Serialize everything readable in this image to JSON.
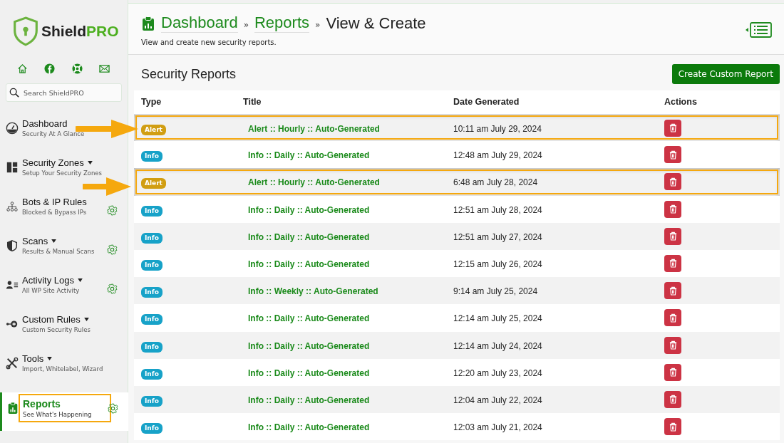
{
  "brand": {
    "name": "Shield",
    "suffix": "PRO"
  },
  "search": {
    "placeholder": "Search ShieldPRO"
  },
  "nav": [
    {
      "title": "Dashboard",
      "subtitle": "Security At A Glance",
      "caret": false,
      "gear": false,
      "selected": false,
      "highlighted": false
    },
    {
      "title": "Security Zones",
      "subtitle": "Setup Your Security Zones",
      "caret": true,
      "gear": false,
      "selected": false,
      "highlighted": false
    },
    {
      "title": "Bots & IP Rules",
      "subtitle": "Blocked & Bypass IPs",
      "caret": false,
      "gear": true,
      "selected": false,
      "highlighted": false
    },
    {
      "title": "Scans",
      "subtitle": "Results & Manual Scans",
      "caret": true,
      "gear": true,
      "selected": false,
      "highlighted": false
    },
    {
      "title": "Activity Logs",
      "subtitle": "All WP Site Activity",
      "caret": true,
      "gear": true,
      "selected": false,
      "highlighted": false
    },
    {
      "title": "Custom Rules",
      "subtitle": "Custom Security Rules",
      "caret": true,
      "gear": false,
      "selected": false,
      "highlighted": false
    },
    {
      "title": "Tools",
      "subtitle": "Import, Whitelabel, Wizard",
      "caret": true,
      "gear": false,
      "selected": false,
      "highlighted": false
    },
    {
      "title": "Reports",
      "subtitle": "See What's Happening",
      "caret": false,
      "gear": true,
      "selected": true,
      "highlighted": true
    }
  ],
  "breadcrumb": [
    {
      "label": "Dashboard",
      "link": true
    },
    {
      "label": "Reports",
      "link": true
    },
    {
      "label": "View & Create",
      "link": false
    }
  ],
  "breadcrumb_separator": "»",
  "page_subtitle": "View and create new security reports.",
  "section_title": "Security Reports",
  "create_button": "Create Custom Report",
  "table": {
    "columns": [
      "Type",
      "Title",
      "Date Generated",
      "Actions"
    ],
    "rows": [
      {
        "type": "Alert",
        "kind": "alert",
        "title": "Alert :: Hourly :: Auto-Generated",
        "date": "10:11 am July 29, 2024",
        "highlighted": true
      },
      {
        "type": "Info",
        "kind": "info",
        "title": "Info :: Daily :: Auto-Generated",
        "date": "12:48 am July 29, 2024",
        "highlighted": false
      },
      {
        "type": "Alert",
        "kind": "alert",
        "title": "Alert :: Hourly :: Auto-Generated",
        "date": "6:48 am July 28, 2024",
        "highlighted": true
      },
      {
        "type": "Info",
        "kind": "info",
        "title": "Info :: Daily :: Auto-Generated",
        "date": "12:51 am July 28, 2024",
        "highlighted": false
      },
      {
        "type": "Info",
        "kind": "info",
        "title": "Info :: Daily :: Auto-Generated",
        "date": "12:51 am July 27, 2024",
        "highlighted": false
      },
      {
        "type": "Info",
        "kind": "info",
        "title": "Info :: Daily :: Auto-Generated",
        "date": "12:15 am July 26, 2024",
        "highlighted": false
      },
      {
        "type": "Info",
        "kind": "info",
        "title": "Info :: Weekly :: Auto-Generated",
        "date": "9:14 am July 25, 2024",
        "highlighted": false
      },
      {
        "type": "Info",
        "kind": "info",
        "title": "Info :: Daily :: Auto-Generated",
        "date": "12:14 am July 25, 2024",
        "highlighted": false
      },
      {
        "type": "Info",
        "kind": "info",
        "title": "Info :: Daily :: Auto-Generated",
        "date": "12:14 am July 24, 2024",
        "highlighted": false
      },
      {
        "type": "Info",
        "kind": "info",
        "title": "Info :: Daily :: Auto-Generated",
        "date": "12:20 am July 23, 2024",
        "highlighted": false
      },
      {
        "type": "Info",
        "kind": "info",
        "title": "Info :: Daily :: Auto-Generated",
        "date": "12:04 am July 22, 2024",
        "highlighted": false
      },
      {
        "type": "Info",
        "kind": "info",
        "title": "Info :: Daily :: Auto-Generated",
        "date": "12:03 am July 21, 2024",
        "highlighted": false
      }
    ]
  }
}
